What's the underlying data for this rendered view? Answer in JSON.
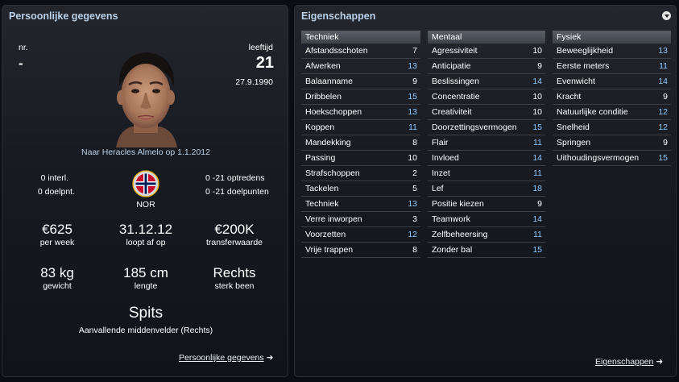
{
  "personal": {
    "title": "Persoonlijke gegevens",
    "number_label": "nr.",
    "number_value": "-",
    "age_label": "leeftijd",
    "age_value": "21",
    "dob": "27.9.1990",
    "transfer_note": "Naar Heracles Almelo op 1.1.2012",
    "intl_caps": "0 interl.",
    "intl_goals": "0 doelpnt.",
    "nation": "NOR",
    "u21_apps": "0 -21 optredens",
    "u21_goals": "0 -21 doelpunten",
    "wage_value": "€625",
    "wage_label": "per week",
    "contract_value": "31.12.12",
    "contract_label": "loopt af op",
    "value_value": "€200K",
    "value_label": "transferwaarde",
    "weight_value": "83 kg",
    "weight_label": "gewicht",
    "height_value": "185 cm",
    "height_label": "lengte",
    "foot_value": "Rechts",
    "foot_label": "sterk been",
    "position_main": "Spits",
    "position_sub": "Aanvallende middenvelder (Rechts)",
    "link_label": "Persoonlijke gegevens",
    "link_arrow": "➜"
  },
  "attributes": {
    "title": "Eigenschappen",
    "link_label": "Eigenschappen",
    "link_arrow": "➜",
    "value_colors": {
      "normal": "#ffffff",
      "good": "#8ec8ff"
    },
    "technical": {
      "header": "Techniek",
      "rows": [
        {
          "name": "Afstandsschoten",
          "value": "7"
        },
        {
          "name": "Afwerken",
          "value": "13"
        },
        {
          "name": "Balaanname",
          "value": "9"
        },
        {
          "name": "Dribbelen",
          "value": "15"
        },
        {
          "name": "Hoekschoppen",
          "value": "13"
        },
        {
          "name": "Koppen",
          "value": "11"
        },
        {
          "name": "Mandekking",
          "value": "8"
        },
        {
          "name": "Passing",
          "value": "10"
        },
        {
          "name": "Strafschoppen",
          "value": "2"
        },
        {
          "name": "Tackelen",
          "value": "5"
        },
        {
          "name": "Techniek",
          "value": "13"
        },
        {
          "name": "Verre inworpen",
          "value": "3"
        },
        {
          "name": "Voorzetten",
          "value": "12"
        },
        {
          "name": "Vrije trappen",
          "value": "8"
        }
      ]
    },
    "mental": {
      "header": "Mentaal",
      "rows": [
        {
          "name": "Agressiviteit",
          "value": "10"
        },
        {
          "name": "Anticipatie",
          "value": "9"
        },
        {
          "name": "Beslissingen",
          "value": "14"
        },
        {
          "name": "Concentratie",
          "value": "10"
        },
        {
          "name": "Creativiteit",
          "value": "10"
        },
        {
          "name": "Doorzettingsvermogen",
          "value": "15"
        },
        {
          "name": "Flair",
          "value": "11"
        },
        {
          "name": "Invloed",
          "value": "14"
        },
        {
          "name": "Inzet",
          "value": "11"
        },
        {
          "name": "Lef",
          "value": "18"
        },
        {
          "name": "Positie kiezen",
          "value": "9"
        },
        {
          "name": "Teamwork",
          "value": "14"
        },
        {
          "name": "Zelfbeheersing",
          "value": "11"
        },
        {
          "name": "Zonder bal",
          "value": "15"
        }
      ]
    },
    "physical": {
      "header": "Fysiek",
      "rows": [
        {
          "name": "Beweeglijkheid",
          "value": "13"
        },
        {
          "name": "Eerste meters",
          "value": "11"
        },
        {
          "name": "Evenwicht",
          "value": "14"
        },
        {
          "name": "Kracht",
          "value": "9"
        },
        {
          "name": "Natuurlijke conditie",
          "value": "12"
        },
        {
          "name": "Snelheid",
          "value": "12"
        },
        {
          "name": "Springen",
          "value": "9"
        },
        {
          "name": "Uithoudingsvermogen",
          "value": "15"
        }
      ]
    }
  }
}
